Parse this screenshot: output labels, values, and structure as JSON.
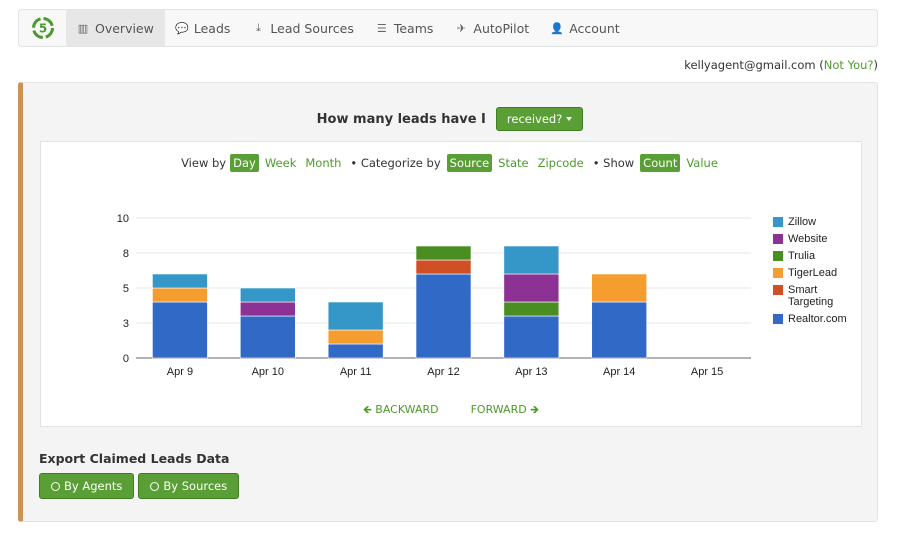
{
  "nav": {
    "items": [
      {
        "label": "Overview",
        "icon": "bar-chart-icon",
        "glyph": "▥",
        "active": true
      },
      {
        "label": "Leads",
        "icon": "comments-icon",
        "glyph": "💬",
        "active": false
      },
      {
        "label": "Lead Sources",
        "icon": "download-icon",
        "glyph": "⤓",
        "active": false
      },
      {
        "label": "Teams",
        "icon": "list-icon",
        "glyph": "☰",
        "active": false
      },
      {
        "label": "AutoPilot",
        "icon": "plane-icon",
        "glyph": "✈",
        "active": false
      },
      {
        "label": "Account",
        "icon": "user-icon",
        "glyph": "👤",
        "active": false
      }
    ]
  },
  "user": {
    "email": "kellyagent@gmail.com",
    "open_paren": " (",
    "not_you": "Not You?",
    "close_paren": ")"
  },
  "question": {
    "text": "How many leads have I",
    "dropdown": "received?"
  },
  "controls": {
    "view_by_label": "View by",
    "view_by": [
      {
        "label": "Day",
        "selected": true
      },
      {
        "label": "Week",
        "selected": false
      },
      {
        "label": "Month",
        "selected": false
      }
    ],
    "categorize_label": "• Categorize by",
    "categorize_by": [
      {
        "label": "Source",
        "selected": true
      },
      {
        "label": "State",
        "selected": false
      },
      {
        "label": "Zipcode",
        "selected": false
      }
    ],
    "show_label": "• Show",
    "show": [
      {
        "label": "Count",
        "selected": true
      },
      {
        "label": "Value",
        "selected": false
      }
    ]
  },
  "pager": {
    "backward": "BACKWARD",
    "forward": "FORWARD"
  },
  "export": {
    "title": "Export Claimed Leads Data",
    "by_agents": "By Agents",
    "by_sources": "By Sources"
  },
  "colors": {
    "accent": "#5a9f35",
    "panel_border": "#cd9353"
  },
  "chart_data": {
    "type": "bar",
    "stacked": true,
    "categories": [
      "Apr 9",
      "Apr 10",
      "Apr 11",
      "Apr 12",
      "Apr 13",
      "Apr 14",
      "Apr 15"
    ],
    "series": [
      {
        "name": "Realtor.com",
        "color": "#3169c6",
        "values": [
          4,
          3,
          1,
          6,
          3,
          4,
          0
        ]
      },
      {
        "name": "Smart Targeting",
        "color": "#d04f25",
        "values": [
          0,
          0,
          0,
          1,
          0,
          0,
          0
        ]
      },
      {
        "name": "TigerLead",
        "color": "#f59d2e",
        "values": [
          1,
          0,
          1,
          0,
          0,
          2,
          0
        ]
      },
      {
        "name": "Trulia",
        "color": "#4a8e22",
        "values": [
          0,
          0,
          0,
          1,
          1,
          0,
          0
        ]
      },
      {
        "name": "Website",
        "color": "#8d3295",
        "values": [
          0,
          1,
          0,
          0,
          2,
          0,
          0
        ]
      },
      {
        "name": "Zillow",
        "color": "#3497c8",
        "values": [
          1,
          1,
          2,
          0,
          2,
          0,
          0
        ]
      }
    ],
    "legend_order": [
      "Zillow",
      "Website",
      "Trulia",
      "TigerLead",
      "Smart Targeting",
      "Realtor.com"
    ],
    "yticks": [
      0,
      2.5,
      5,
      7.5,
      10
    ],
    "ytick_labels": [
      "0",
      "3",
      "5",
      "8",
      "10"
    ],
    "ylim": [
      0,
      10
    ],
    "title": "",
    "xlabel": "",
    "ylabel": "",
    "grid": true,
    "legend_position": "right"
  }
}
